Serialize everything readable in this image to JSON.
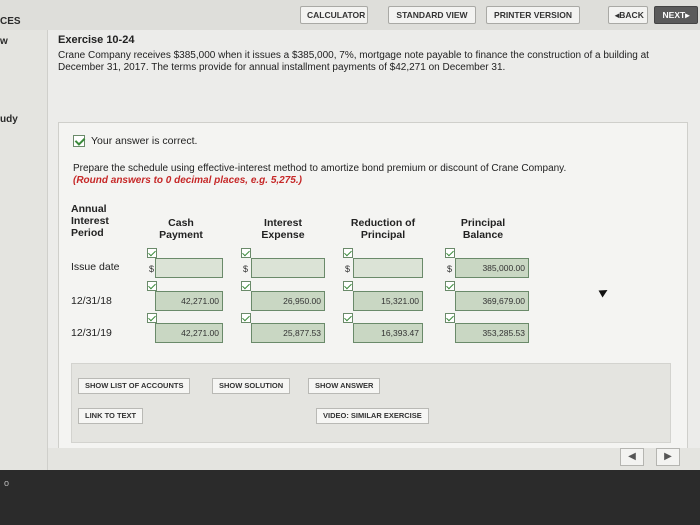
{
  "toolbar": {
    "calculator": "CALCULATOR",
    "standard_view": "STANDARD VIEW",
    "printer_version": "PRINTER VERSION",
    "back": "BACK",
    "next": "NEXT"
  },
  "leftnav": {
    "t1": "CES",
    "t2": "w",
    "t3": "udy",
    "t4": "o"
  },
  "exercise": {
    "title": "Exercise 10-24",
    "text": "Crane Company receives $385,000 when it issues a $385,000, 7%, mortgage note payable to finance the construction of a building at December 31, 2017. The terms provide for annual installment payments of $42,271 on December 31."
  },
  "result": {
    "message": "Your answer is correct."
  },
  "instructions": {
    "main": "Prepare the schedule using effective-interest method to amortize bond premium or discount of Crane Company.",
    "note": "(Round answers to 0 decimal places, e.g. 5,275.)"
  },
  "table": {
    "headers": {
      "period": "Annual Interest Period",
      "cash": "Cash Payment",
      "interest": "Interest Expense",
      "reduction": "Reduction of Principal",
      "balance": "Principal Balance"
    },
    "rows": [
      {
        "period": "Issue date",
        "cash": "",
        "interest": "",
        "reduction": "",
        "balance": "385,000.00"
      },
      {
        "period": "12/31/18",
        "cash": "42,271.00",
        "interest": "26,950.00",
        "reduction": "15,321.00",
        "balance": "369,679.00"
      },
      {
        "period": "12/31/19",
        "cash": "42,271.00",
        "interest": "25,877.53",
        "reduction": "16,393.47",
        "balance": "353,285.53"
      }
    ],
    "currency_symbol": "$"
  },
  "actions": {
    "show_accounts": "SHOW LIST OF ACCOUNTS",
    "show_solution": "SHOW SOLUTION",
    "show_answer": "SHOW ANSWER",
    "link_to_text": "LINK TO TEXT",
    "video": "VIDEO: SIMILAR EXERCISE"
  },
  "nav": {
    "prev": "◀",
    "next": "▶"
  }
}
